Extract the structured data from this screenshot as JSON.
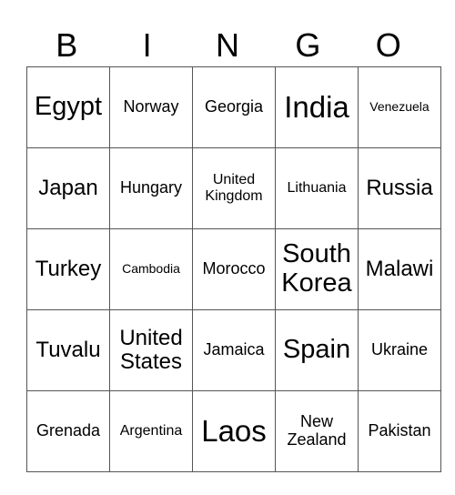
{
  "header": {
    "letters": [
      "B",
      "I",
      "N",
      "G",
      "O"
    ]
  },
  "cells": [
    [
      {
        "t": "Egypt",
        "s": "s4"
      },
      {
        "t": "Norway",
        "s": "s2"
      },
      {
        "t": "Georgia",
        "s": "s2"
      },
      {
        "t": "India",
        "s": "s5"
      },
      {
        "t": "Venezuela",
        "s": "s0"
      }
    ],
    [
      {
        "t": "Japan",
        "s": "s3"
      },
      {
        "t": "Hungary",
        "s": "s2"
      },
      {
        "t": "United Kingdom",
        "s": "s1"
      },
      {
        "t": "Lithuania",
        "s": "s1"
      },
      {
        "t": "Russia",
        "s": "s3"
      }
    ],
    [
      {
        "t": "Turkey",
        "s": "s3"
      },
      {
        "t": "Cambodia",
        "s": "s0"
      },
      {
        "t": "Morocco",
        "s": "s2"
      },
      {
        "t": "South Korea",
        "s": "s4"
      },
      {
        "t": "Malawi",
        "s": "s3"
      }
    ],
    [
      {
        "t": "Tuvalu",
        "s": "s3"
      },
      {
        "t": "United States",
        "s": "s3"
      },
      {
        "t": "Jamaica",
        "s": "s2"
      },
      {
        "t": "Spain",
        "s": "s4"
      },
      {
        "t": "Ukraine",
        "s": "s2"
      }
    ],
    [
      {
        "t": "Grenada",
        "s": "s2"
      },
      {
        "t": "Argentina",
        "s": "s1"
      },
      {
        "t": "Laos",
        "s": "s5"
      },
      {
        "t": "New Zealand",
        "s": "s2"
      },
      {
        "t": "Pakistan",
        "s": "s2"
      }
    ]
  ]
}
